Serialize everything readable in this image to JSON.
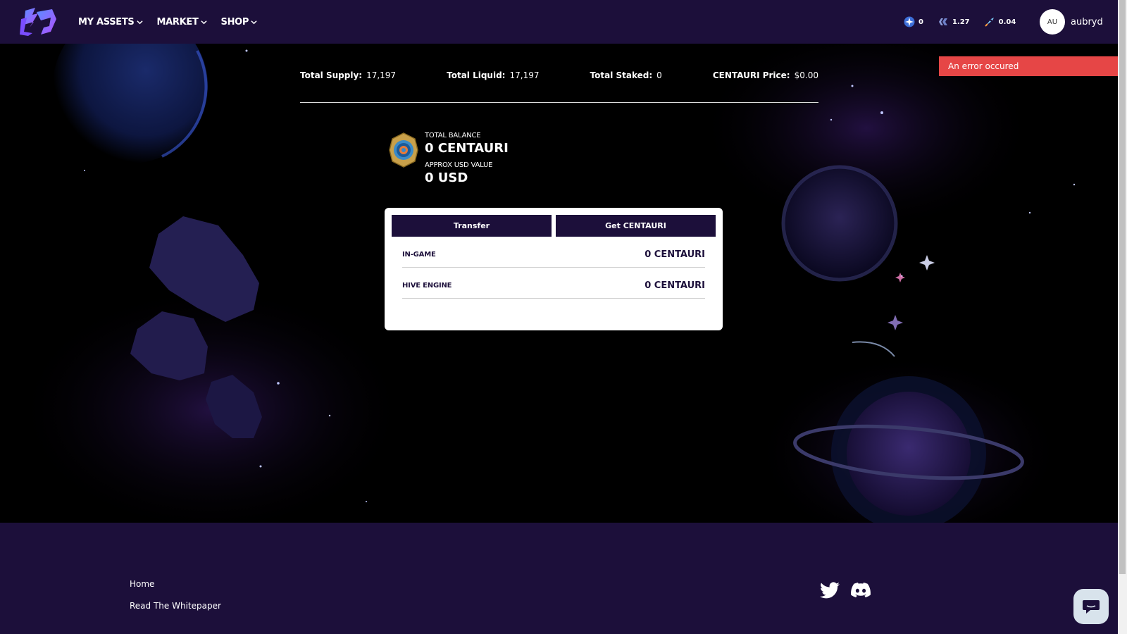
{
  "header": {
    "logo": "game-logo",
    "nav": [
      {
        "label": "MY ASSETS",
        "icon": "chevron-down-icon"
      },
      {
        "label": "MARKET",
        "icon": "chevron-down-icon"
      },
      {
        "label": "SHOP",
        "icon": "chevron-down-icon"
      }
    ],
    "tokens": [
      {
        "icon": "star-token-icon",
        "value": "0"
      },
      {
        "icon": "hive-token-icon",
        "value": "1.27"
      },
      {
        "icon": "rocket-token-icon",
        "value": "0.04"
      }
    ],
    "user": {
      "initials": "AU",
      "name": "aubryd"
    }
  },
  "stats": [
    {
      "label": "Total Supply:",
      "value": "17,197"
    },
    {
      "label": "Total Liquid:",
      "value": "17,197"
    },
    {
      "label": "Total Staked:",
      "value": "0"
    },
    {
      "label": "CENTAURI Price:",
      "value": "$0.00"
    }
  ],
  "toast": {
    "message": "An error occured",
    "color": "#e64646"
  },
  "balance": {
    "total_label": "TOTAL BALANCE",
    "total_value": "0 CENTAURI",
    "usd_label": "APPROX USD VALUE",
    "usd_value": "0 USD",
    "icon": "centauri-coin-icon"
  },
  "card": {
    "buttons": {
      "transfer": "Transfer",
      "get": "Get CENTAURI"
    },
    "rows": [
      {
        "label": "IN-GAME",
        "value": "0 CENTAURI"
      },
      {
        "label": "HIVE ENGINE",
        "value": "0 CENTAURI"
      }
    ]
  },
  "footer": {
    "links": [
      "Home",
      "Read The Whitepaper"
    ],
    "social": [
      "twitter-icon",
      "discord-icon"
    ]
  },
  "colors": {
    "brand": "#1c0f3a",
    "error": "#e64646",
    "card": "#ffffff"
  }
}
